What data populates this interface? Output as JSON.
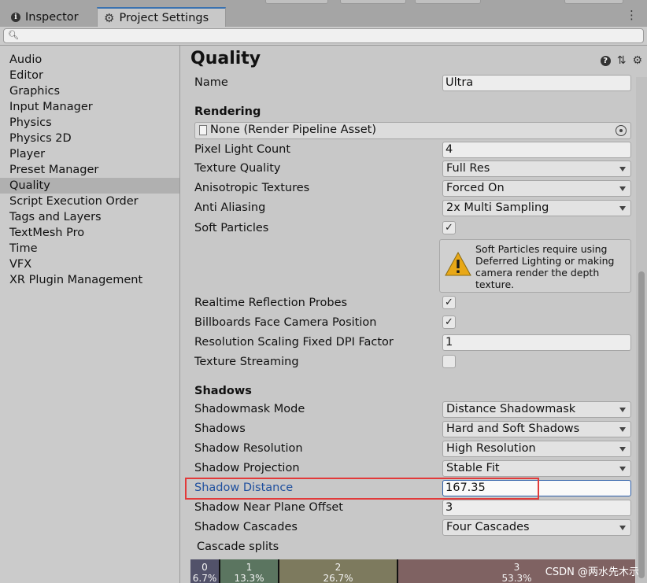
{
  "tabs": [
    {
      "label": "Inspector",
      "icon": "info-icon",
      "icon_glyph": "i"
    },
    {
      "label": "Project Settings",
      "icon": "gear-icon",
      "active": true
    }
  ],
  "sidebar": {
    "items": [
      {
        "label": "Audio"
      },
      {
        "label": "Editor"
      },
      {
        "label": "Graphics"
      },
      {
        "label": "Input Manager"
      },
      {
        "label": "Physics"
      },
      {
        "label": "Physics 2D"
      },
      {
        "label": "Player"
      },
      {
        "label": "Preset Manager"
      },
      {
        "label": "Quality",
        "selected": true
      },
      {
        "label": "Script Execution Order"
      },
      {
        "label": "Tags and Layers"
      },
      {
        "label": "TextMesh Pro"
      },
      {
        "label": "Time"
      },
      {
        "label": "VFX"
      },
      {
        "label": "XR Plugin Management"
      }
    ]
  },
  "header": {
    "title": "Quality",
    "help_glyph": "?"
  },
  "quality": {
    "name_label": "Name",
    "name_value": "Ultra",
    "rendering_header": "Rendering",
    "render_pipeline_asset": "None (Render Pipeline Asset)",
    "pixel_light_count_label": "Pixel Light Count",
    "pixel_light_count": "4",
    "texture_quality_label": "Texture Quality",
    "texture_quality": "Full Res",
    "anisotropic_label": "Anisotropic Textures",
    "anisotropic": "Forced On",
    "anti_aliasing_label": "Anti Aliasing",
    "anti_aliasing": "2x Multi Sampling",
    "soft_particles_label": "Soft Particles",
    "soft_particles": true,
    "soft_particles_warning": "Soft Particles require using Deferred Lighting or making camera render the depth texture.",
    "realtime_reflection_label": "Realtime Reflection Probes",
    "realtime_reflection": true,
    "billboards_label": "Billboards Face Camera Position",
    "billboards": true,
    "resolution_scaling_label": "Resolution Scaling Fixed DPI Factor",
    "resolution_scaling": "1",
    "texture_streaming_label": "Texture Streaming",
    "texture_streaming": false,
    "shadows_header": "Shadows",
    "shadowmask_mode_label": "Shadowmask Mode",
    "shadowmask_mode": "Distance Shadowmask",
    "shadows_label": "Shadows",
    "shadows": "Hard and Soft Shadows",
    "shadow_resolution_label": "Shadow Resolution",
    "shadow_resolution": "High Resolution",
    "shadow_projection_label": "Shadow Projection",
    "shadow_projection": "Stable Fit",
    "shadow_distance_label": "Shadow Distance",
    "shadow_distance": "167.35",
    "shadow_near_plane_label": "Shadow Near Plane Offset",
    "shadow_near_plane": "3",
    "shadow_cascades_label": "Shadow Cascades",
    "shadow_cascades": "Four Cascades",
    "cascade_splits_label": "Cascade splits",
    "cascade_splits": [
      {
        "index": "0",
        "percent": "6.7%",
        "fraction": 0.067,
        "color": "#52526a"
      },
      {
        "index": "1",
        "percent": "13.3%",
        "fraction": 0.133,
        "color": "#5b7560"
      },
      {
        "index": "2",
        "percent": "26.7%",
        "fraction": 0.267,
        "color": "#7d7a5e"
      },
      {
        "index": "3",
        "percent": "53.3%",
        "fraction": 0.533,
        "color": "#7f6262"
      }
    ]
  },
  "watermark": "CSDN @两水先木示",
  "colors": {
    "accent": "#3a72b0",
    "highlight_box": "#e23a3a",
    "link_label": "#1e4f9e"
  }
}
